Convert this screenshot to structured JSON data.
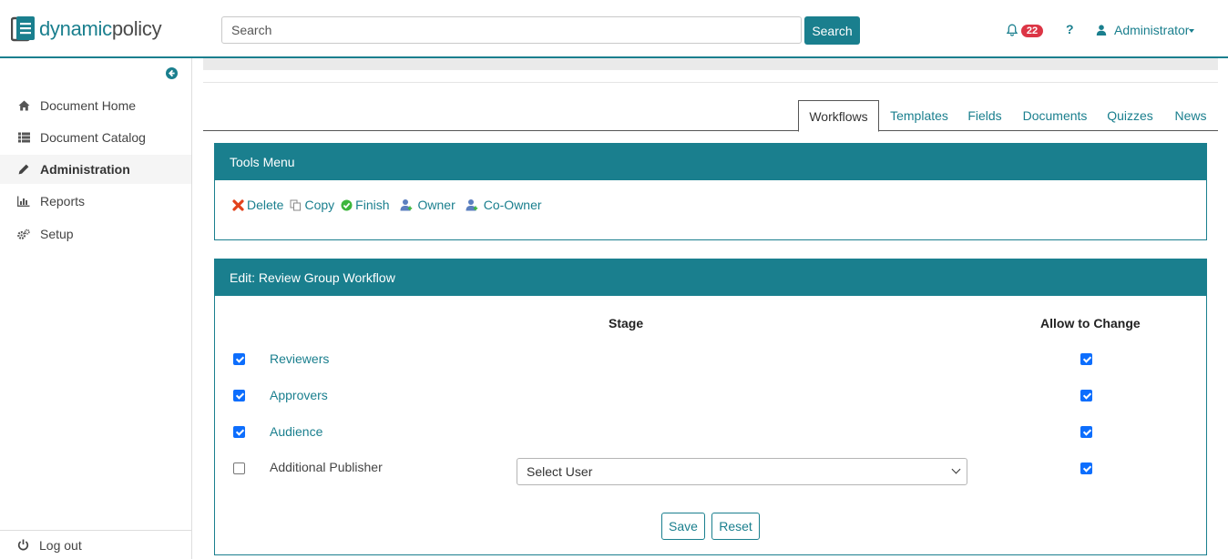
{
  "brand": {
    "part1": "dynamic",
    "part2": "policy"
  },
  "header": {
    "search_placeholder": "Search",
    "search_button": "Search",
    "notifications_count": "22",
    "help_label": "?",
    "user_name": "Administrator"
  },
  "sidebar": {
    "items": [
      {
        "label": "Document Home",
        "icon": "home-icon"
      },
      {
        "label": "Document Catalog",
        "icon": "list-icon"
      },
      {
        "label": "Administration",
        "icon": "pencil-icon"
      },
      {
        "label": "Reports",
        "icon": "bar-chart-icon"
      },
      {
        "label": "Setup",
        "icon": "gears-icon"
      }
    ],
    "logout": "Log out"
  },
  "tabs": [
    "Workflows",
    "Templates",
    "Fields",
    "Documents",
    "Quizzes",
    "News"
  ],
  "tools_panel": {
    "title": "Tools Menu",
    "items": [
      "Delete",
      "Copy",
      "Finish",
      "Owner",
      "Co-Owner"
    ]
  },
  "edit_panel": {
    "title": "Edit: Review Group Workflow",
    "col_stage": "Stage",
    "col_allow": "Allow to Change",
    "rows": [
      {
        "label": "Reviewers",
        "checked": true,
        "allow": true
      },
      {
        "label": "Approvers",
        "checked": true,
        "allow": true
      },
      {
        "label": "Audience",
        "checked": true,
        "allow": true
      },
      {
        "label": "Additional Publisher",
        "checked": false,
        "allow": true
      }
    ],
    "select_user": "Select User",
    "save": "Save",
    "reset": "Reset"
  },
  "colors": {
    "accent": "#1a7f8e",
    "badge": "#dc3545",
    "checkbox": "#0d6efd"
  }
}
